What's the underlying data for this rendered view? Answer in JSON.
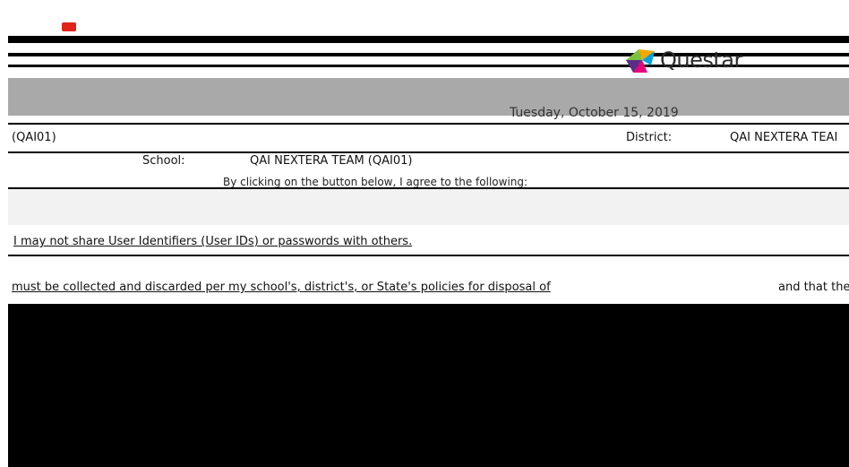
{
  "header": {
    "brand": "Questar"
  },
  "date_line": "Tuesday, October 15, 2019",
  "info": {
    "code_left": "(QAI01)",
    "district_label": "District:",
    "district_value": "QAI NEXTERA TEAI",
    "school_label": "School:",
    "school_value": "QAI NEXTERA TEAM (QAI01)"
  },
  "notice": {
    "text": "By clicking on the button below, I agree to the following:"
  },
  "terms": {
    "bullet": "I may not share User Identifiers (User IDs) or passwords with others.",
    "dispose_left": "must be collected and discarded per my school's, district's, or State's policies for disposal of",
    "dispose_right": "and that the"
  },
  "colors": {
    "banner": "#a9a9a9",
    "accent_red": "#e2231a",
    "logo": [
      "#7cc242",
      "#00a3e0",
      "#e6007e",
      "#f7a800",
      "#5b2d86"
    ]
  }
}
